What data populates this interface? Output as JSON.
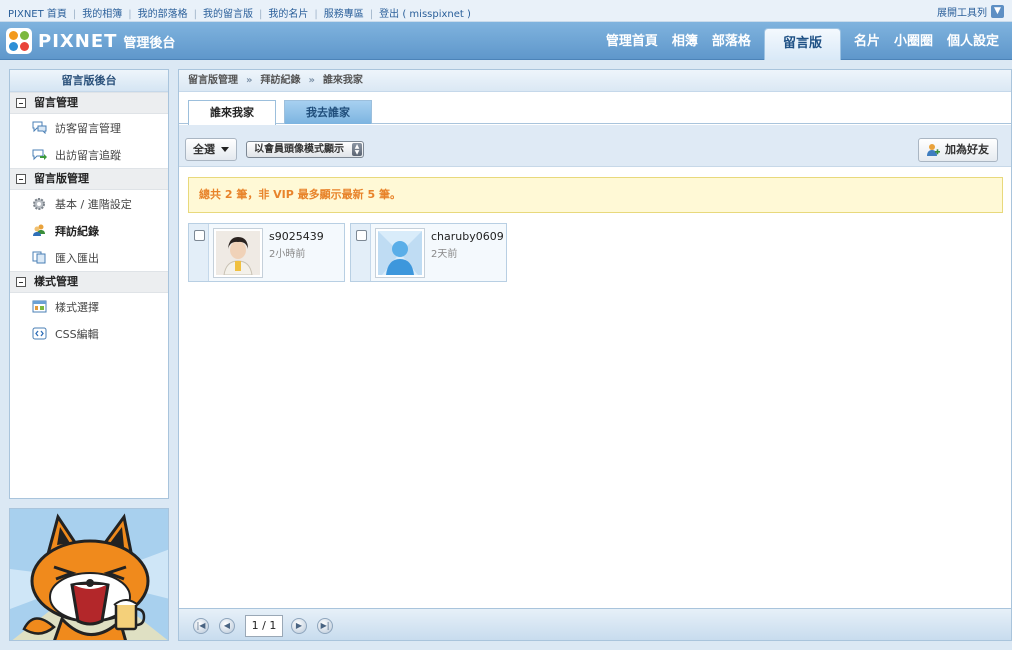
{
  "toplinks": {
    "items": [
      "PIXNET 首頁",
      "我的相簿",
      "我的部落格",
      "我的留言版",
      "我的名片",
      "服務專區",
      "登出 ( misspixnet )"
    ],
    "tools_label": "展開工具列"
  },
  "header": {
    "logo_text": "PIXNET",
    "logo_sub": "管理後台",
    "nav": [
      "管理首頁",
      "相簿",
      "部落格",
      "留言版",
      "名片",
      "小圈圈",
      "個人設定"
    ],
    "active_nav": "留言版"
  },
  "sidebar": {
    "title": "留言版後台",
    "sections": [
      {
        "label": "留言管理",
        "items": [
          "訪客留言管理",
          "出訪留言追蹤"
        ]
      },
      {
        "label": "留言版管理",
        "items": [
          "基本 / 進階設定",
          "拜訪紀錄",
          "匯入匯出"
        ]
      },
      {
        "label": "樣式管理",
        "items": [
          "樣式選擇",
          "CSS編輯"
        ]
      }
    ],
    "active_item": "拜訪紀錄"
  },
  "main": {
    "breadcrumb": [
      "留言版管理",
      "拜訪紀錄",
      "誰來我家"
    ],
    "tabs": [
      "誰來我家",
      "我去誰家"
    ],
    "active_tab": "誰來我家",
    "toolbar": {
      "select_all": "全選",
      "view_mode": "以會員頭像模式顯示",
      "add_friend": "加為好友"
    },
    "notice": "總共 2 筆，非 VIP 最多顯示最新 5 筆。",
    "visitors": [
      {
        "name": "s9025439",
        "time": "2小時前"
      },
      {
        "name": "charuby0609",
        "time": "2天前"
      }
    ],
    "pager": {
      "page": "1 / 1"
    }
  },
  "colors": {
    "header": "#6ea5d5",
    "accent": "#e8832a",
    "notice_bg": "#fff9d6"
  }
}
